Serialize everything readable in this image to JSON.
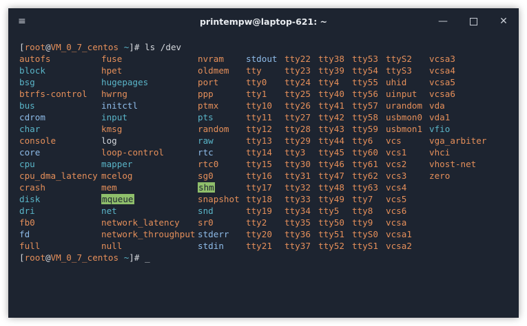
{
  "window": {
    "title": "printempw@laptop-621: ~",
    "menu_icon": "≡",
    "minimize_glyph": "—",
    "close_glyph": "✕"
  },
  "prompt": {
    "open_bracket": "[",
    "user": "root",
    "at": "@",
    "host": "VM_0_7_centos",
    "path": "~",
    "close": "]#"
  },
  "command": " ls /dev",
  "cursor": "_",
  "colors": {
    "file": "#e58f5a",
    "dir": "#5ab5c8",
    "link": "#8ebbe8",
    "socket": "#b57fd6",
    "highlight": "#8fbf6b"
  },
  "columns": [
    [
      {
        "t": "autofs",
        "c": "file"
      },
      {
        "t": "block",
        "c": "dir"
      },
      {
        "t": "bsg",
        "c": "dir"
      },
      {
        "t": "btrfs-control",
        "c": "file"
      },
      {
        "t": "bus",
        "c": "dir"
      },
      {
        "t": "cdrom",
        "c": "link"
      },
      {
        "t": "char",
        "c": "dir"
      },
      {
        "t": "console",
        "c": "file"
      },
      {
        "t": "core",
        "c": "link"
      },
      {
        "t": "cpu",
        "c": "dir"
      },
      {
        "t": "cpu_dma_latency",
        "c": "file"
      },
      {
        "t": "crash",
        "c": "file"
      },
      {
        "t": "disk",
        "c": "dir"
      },
      {
        "t": "dri",
        "c": "dir"
      },
      {
        "t": "fb0",
        "c": "file"
      },
      {
        "t": "fd",
        "c": "link"
      },
      {
        "t": "full",
        "c": "file"
      }
    ],
    [
      {
        "t": "fuse",
        "c": "file"
      },
      {
        "t": "hpet",
        "c": "file"
      },
      {
        "t": "hugepages",
        "c": "dir"
      },
      {
        "t": "hwrng",
        "c": "file"
      },
      {
        "t": "initctl",
        "c": "link"
      },
      {
        "t": "input",
        "c": "dir"
      },
      {
        "t": "kmsg",
        "c": "file"
      },
      {
        "t": "log",
        "c": "socket"
      },
      {
        "t": "loop-control",
        "c": "file"
      },
      {
        "t": "mapper",
        "c": "dir"
      },
      {
        "t": "mcelog",
        "c": "file"
      },
      {
        "t": "mem",
        "c": "file"
      },
      {
        "t": "mqueue",
        "c": "hl"
      },
      {
        "t": "net",
        "c": "dir"
      },
      {
        "t": "network_latency",
        "c": "file"
      },
      {
        "t": "network_throughput",
        "c": "file"
      },
      {
        "t": "null",
        "c": "file"
      }
    ],
    [
      {
        "t": "nvram",
        "c": "file"
      },
      {
        "t": "oldmem",
        "c": "file"
      },
      {
        "t": "port",
        "c": "file"
      },
      {
        "t": "ppp",
        "c": "file"
      },
      {
        "t": "ptmx",
        "c": "file"
      },
      {
        "t": "pts",
        "c": "dir"
      },
      {
        "t": "random",
        "c": "file"
      },
      {
        "t": "raw",
        "c": "dir"
      },
      {
        "t": "rtc",
        "c": "link"
      },
      {
        "t": "rtc0",
        "c": "file"
      },
      {
        "t": "sg0",
        "c": "file"
      },
      {
        "t": "shm",
        "c": "hl"
      },
      {
        "t": "snapshot",
        "c": "file"
      },
      {
        "t": "snd",
        "c": "dir"
      },
      {
        "t": "sr0",
        "c": "file"
      },
      {
        "t": "stderr",
        "c": "link"
      },
      {
        "t": "stdin",
        "c": "link"
      }
    ],
    [
      {
        "t": "stdout",
        "c": "link"
      },
      {
        "t": "tty",
        "c": "file"
      },
      {
        "t": "tty0",
        "c": "file"
      },
      {
        "t": "tty1",
        "c": "file"
      },
      {
        "t": "tty10",
        "c": "file"
      },
      {
        "t": "tty11",
        "c": "file"
      },
      {
        "t": "tty12",
        "c": "file"
      },
      {
        "t": "tty13",
        "c": "file"
      },
      {
        "t": "tty14",
        "c": "file"
      },
      {
        "t": "tty15",
        "c": "file"
      },
      {
        "t": "tty16",
        "c": "file"
      },
      {
        "t": "tty17",
        "c": "file"
      },
      {
        "t": "tty18",
        "c": "file"
      },
      {
        "t": "tty19",
        "c": "file"
      },
      {
        "t": "tty2",
        "c": "file"
      },
      {
        "t": "tty20",
        "c": "file"
      },
      {
        "t": "tty21",
        "c": "file"
      }
    ],
    [
      {
        "t": "tty22",
        "c": "file"
      },
      {
        "t": "tty23",
        "c": "file"
      },
      {
        "t": "tty24",
        "c": "file"
      },
      {
        "t": "tty25",
        "c": "file"
      },
      {
        "t": "tty26",
        "c": "file"
      },
      {
        "t": "tty27",
        "c": "file"
      },
      {
        "t": "tty28",
        "c": "file"
      },
      {
        "t": "tty29",
        "c": "file"
      },
      {
        "t": "tty3",
        "c": "file"
      },
      {
        "t": "tty30",
        "c": "file"
      },
      {
        "t": "tty31",
        "c": "file"
      },
      {
        "t": "tty32",
        "c": "file"
      },
      {
        "t": "tty33",
        "c": "file"
      },
      {
        "t": "tty34",
        "c": "file"
      },
      {
        "t": "tty35",
        "c": "file"
      },
      {
        "t": "tty36",
        "c": "file"
      },
      {
        "t": "tty37",
        "c": "file"
      }
    ],
    [
      {
        "t": "tty38",
        "c": "file"
      },
      {
        "t": "tty39",
        "c": "file"
      },
      {
        "t": "tty4",
        "c": "file"
      },
      {
        "t": "tty40",
        "c": "file"
      },
      {
        "t": "tty41",
        "c": "file"
      },
      {
        "t": "tty42",
        "c": "file"
      },
      {
        "t": "tty43",
        "c": "file"
      },
      {
        "t": "tty44",
        "c": "file"
      },
      {
        "t": "tty45",
        "c": "file"
      },
      {
        "t": "tty46",
        "c": "file"
      },
      {
        "t": "tty47",
        "c": "file"
      },
      {
        "t": "tty48",
        "c": "file"
      },
      {
        "t": "tty49",
        "c": "file"
      },
      {
        "t": "tty5",
        "c": "file"
      },
      {
        "t": "tty50",
        "c": "file"
      },
      {
        "t": "tty51",
        "c": "file"
      },
      {
        "t": "tty52",
        "c": "file"
      }
    ],
    [
      {
        "t": "tty53",
        "c": "file"
      },
      {
        "t": "tty54",
        "c": "file"
      },
      {
        "t": "tty55",
        "c": "file"
      },
      {
        "t": "tty56",
        "c": "file"
      },
      {
        "t": "tty57",
        "c": "file"
      },
      {
        "t": "tty58",
        "c": "file"
      },
      {
        "t": "tty59",
        "c": "file"
      },
      {
        "t": "tty6",
        "c": "file"
      },
      {
        "t": "tty60",
        "c": "file"
      },
      {
        "t": "tty61",
        "c": "file"
      },
      {
        "t": "tty62",
        "c": "file"
      },
      {
        "t": "tty63",
        "c": "file"
      },
      {
        "t": "tty7",
        "c": "file"
      },
      {
        "t": "tty8",
        "c": "file"
      },
      {
        "t": "tty9",
        "c": "file"
      },
      {
        "t": "ttyS0",
        "c": "file"
      },
      {
        "t": "ttyS1",
        "c": "file"
      }
    ],
    [
      {
        "t": "ttyS2",
        "c": "file"
      },
      {
        "t": "ttyS3",
        "c": "file"
      },
      {
        "t": "uhid",
        "c": "file"
      },
      {
        "t": "uinput",
        "c": "file"
      },
      {
        "t": "urandom",
        "c": "file"
      },
      {
        "t": "usbmon0",
        "c": "file"
      },
      {
        "t": "usbmon1",
        "c": "file"
      },
      {
        "t": "vcs",
        "c": "file"
      },
      {
        "t": "vcs1",
        "c": "file"
      },
      {
        "t": "vcs2",
        "c": "file"
      },
      {
        "t": "vcs3",
        "c": "file"
      },
      {
        "t": "vcs4",
        "c": "file"
      },
      {
        "t": "vcs5",
        "c": "file"
      },
      {
        "t": "vcs6",
        "c": "file"
      },
      {
        "t": "vcsa",
        "c": "file"
      },
      {
        "t": "vcsa1",
        "c": "file"
      },
      {
        "t": "vcsa2",
        "c": "file"
      }
    ],
    [
      {
        "t": "vcsa3",
        "c": "file"
      },
      {
        "t": "vcsa4",
        "c": "file"
      },
      {
        "t": "vcsa5",
        "c": "file"
      },
      {
        "t": "vcsa6",
        "c": "file"
      },
      {
        "t": "vda",
        "c": "file"
      },
      {
        "t": "vda1",
        "c": "file"
      },
      {
        "t": "vfio",
        "c": "dir"
      },
      {
        "t": "vga_arbiter",
        "c": "file"
      },
      {
        "t": "vhci",
        "c": "file"
      },
      {
        "t": "vhost-net",
        "c": "file"
      },
      {
        "t": "zero",
        "c": "file"
      }
    ]
  ]
}
